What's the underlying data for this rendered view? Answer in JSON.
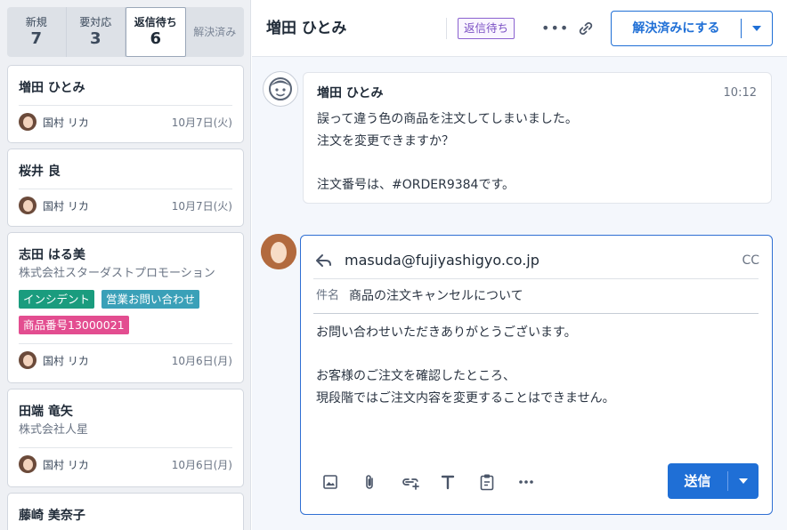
{
  "tabs": [
    {
      "label": "新規",
      "count": "7"
    },
    {
      "label": "要対応",
      "count": "3"
    },
    {
      "label": "返信待ち",
      "count": "6"
    },
    {
      "label": "解決済み"
    }
  ],
  "conversations": [
    {
      "name": "増田 ひとみ",
      "assignee": "国村 リカ",
      "date": "10月7日(火)"
    },
    {
      "name": "桜井 良",
      "assignee": "国村 リカ",
      "date": "10月7日(火)"
    },
    {
      "name": "志田 はる美",
      "company": "株式会社スターダストプロモーション",
      "tags": [
        {
          "label": "インシデント",
          "color": "#1a9c7e"
        },
        {
          "label": "営業お問い合わせ",
          "color": "#3aa0b8"
        },
        {
          "label": "商品番号13000021",
          "color": "#e34d90"
        }
      ],
      "assignee": "国村 リカ",
      "date": "10月6日(月)"
    },
    {
      "name": "田端 竜矢",
      "company": "株式会社人星",
      "assignee": "国村 リカ",
      "date": "10月6日(月)"
    },
    {
      "name": "藤崎 美奈子"
    }
  ],
  "header": {
    "title": "増田 ひとみ",
    "status": "返信待ち",
    "more_icon": "more-horizontal-icon",
    "link_icon": "link-icon",
    "resolve_label": "解決済みにする"
  },
  "message": {
    "sender": "増田 ひとみ",
    "time": "10:12",
    "lines": [
      "誤って違う色の商品を注文してしまいました。",
      "注文を変更できますか？",
      "",
      "注文番号は、#ORDER9384です。"
    ]
  },
  "reply": {
    "to": "masuda@fujiyashigyo.co.jp",
    "cc": "CC",
    "subject_label": "件名",
    "subject": "商品の注文キャンセルについて",
    "lines": [
      "お問い合わせいただきありがとうございます。",
      "",
      "お客様のご注文を確認したところ、",
      "現段階ではご注文内容を変更することはできません。"
    ],
    "toolbar_icons": [
      "image-icon",
      "paperclip-icon",
      "insert-link-icon",
      "text-format-icon",
      "clipboard-icon",
      "more-horizontal-icon"
    ],
    "send_label": "送信"
  },
  "colors": {
    "accent": "#1f6fd6",
    "status_purple": "#7a4fc4"
  }
}
